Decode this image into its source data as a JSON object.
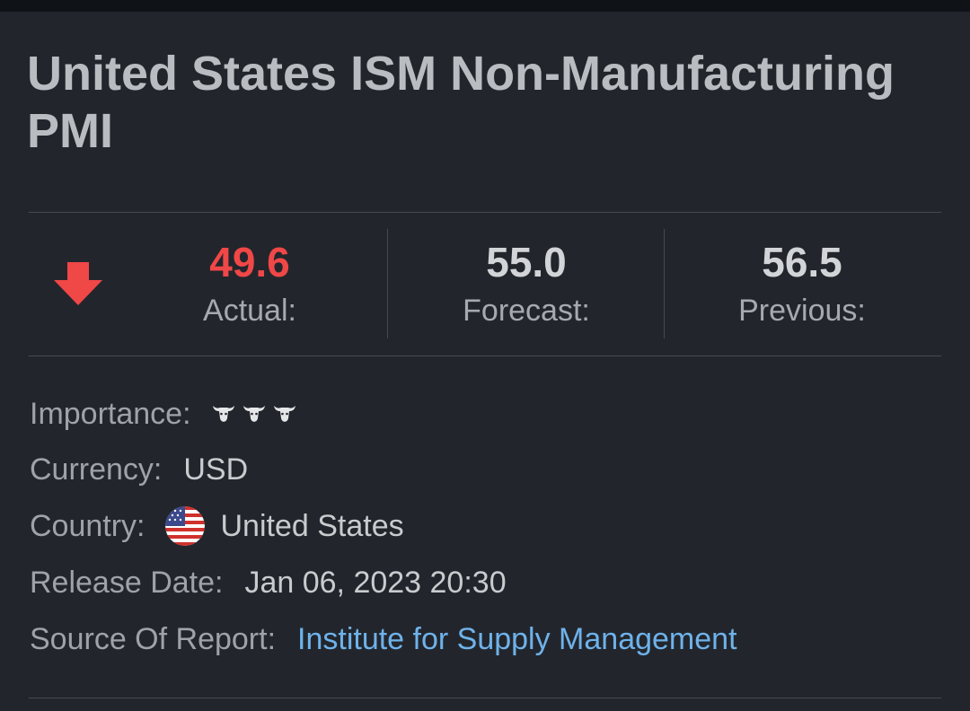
{
  "event": {
    "title": "United States ISM Non-Manufacturing PMI"
  },
  "metrics": {
    "direction": "down",
    "direction_color": "#f04747",
    "actual": {
      "value": "49.6",
      "label": "Actual:"
    },
    "forecast": {
      "value": "55.0",
      "label": "Forecast:"
    },
    "previous": {
      "value": "56.5",
      "label": "Previous:"
    }
  },
  "details": {
    "importance": {
      "label": "Importance:",
      "level": 3,
      "max": 3,
      "icon": "bull-icon"
    },
    "currency": {
      "label": "Currency:",
      "value": "USD"
    },
    "country": {
      "label": "Country:",
      "value": "United States",
      "icon": "us-flag-icon"
    },
    "release_date": {
      "label": "Release Date:",
      "value": "Jan 06, 2023 20:30"
    },
    "source": {
      "label": "Source Of Report:",
      "value": "Institute for Supply Management"
    }
  },
  "colors": {
    "background": "#22262c",
    "actual": "#f04747",
    "link": "#6fb2ea"
  }
}
